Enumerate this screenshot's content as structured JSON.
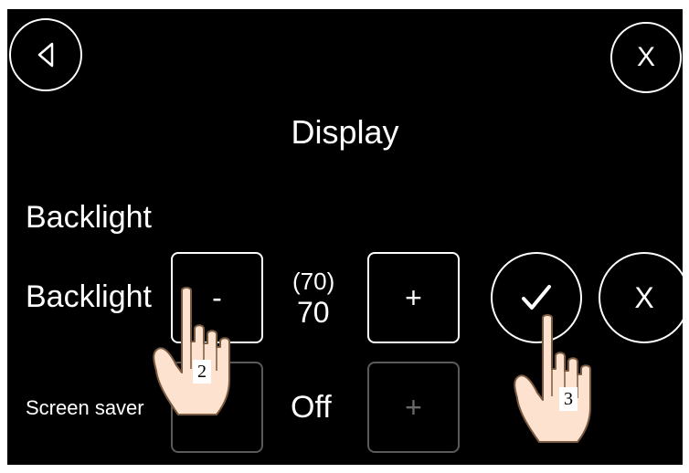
{
  "header": {
    "title": "Display"
  },
  "nav": {
    "back_icon": "back-triangle-icon",
    "close_label": "X"
  },
  "section": {
    "heading": "Backlight"
  },
  "backlight_row": {
    "label": "Backlight",
    "minus_label": "-",
    "plus_label": "+",
    "saved_value": "(70)",
    "current_value": "70",
    "confirm_icon": "checkmark-icon",
    "cancel_label": "X"
  },
  "screensaver_row": {
    "label": "Screen saver",
    "minus_label": "-",
    "plus_label": "+",
    "value": "Off"
  },
  "annotations": [
    {
      "step": "2",
      "icon": "pointing-hand-icon"
    },
    {
      "step": "3",
      "icon": "pointing-hand-icon"
    }
  ],
  "colors": {
    "screen_bg": "#000000",
    "foreground": "#ffffff",
    "disabled": "#5a5a5a",
    "hand_fill": "#fde3cf"
  }
}
